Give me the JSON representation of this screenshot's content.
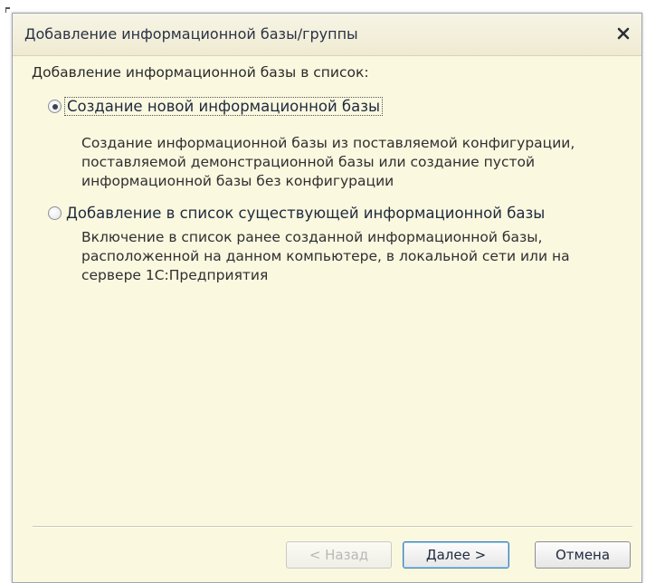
{
  "window": {
    "title": "Добавление информационной базы/группы",
    "close_icon": "close-icon"
  },
  "main": {
    "section_label": "Добавление информационной базы в список:",
    "options": [
      {
        "label": "Создание новой информационной базы",
        "selected": true,
        "description": [
          "Создание информационной базы из поставляемой конфигурации,",
          "поставляемой демонстрационной базы или создание пустой",
          "информационной базы без конфигурации"
        ]
      },
      {
        "label": "Добавление в список существующей информационной базы",
        "selected": false,
        "description": [
          "Включение в список ранее созданной информационной базы,",
          "расположенной на данном компьютере,  в локальной сети или на",
          "сервере 1С:Предприятия"
        ]
      }
    ]
  },
  "footer": {
    "back_label": "< Назад",
    "back_enabled": false,
    "next_label": "Далее >",
    "cancel_label": "Отмена"
  },
  "colors": {
    "dialog_background": "#fbf8e0",
    "title_text": "#2a3244",
    "default_button_border": "#3c7fb1",
    "disabled_text": "#b8b8b8"
  }
}
